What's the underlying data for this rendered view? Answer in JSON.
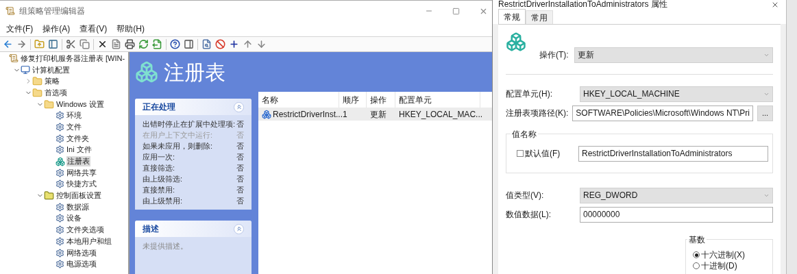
{
  "main_window": {
    "title": "组策略管理编辑器",
    "menu": [
      "文件(F)",
      "操作(A)",
      "查看(V)",
      "帮助(H)"
    ]
  },
  "tree": {
    "label": "修复打印机服务器注册表 [WIN-",
    "kind": "root",
    "selected": false,
    "children": [
      {
        "label": "计算机配置",
        "kind": "computer",
        "selected": false,
        "expanded": true,
        "children": [
          {
            "label": "策略",
            "kind": "folder",
            "selected": false,
            "expanded": false
          },
          {
            "label": "首选项",
            "kind": "folder",
            "selected": false,
            "expanded": true,
            "children": [
              {
                "label": "Windows 设置",
                "kind": "folder",
                "selected": false,
                "expanded": true,
                "children": [
                  {
                    "label": "环境",
                    "kind": "item",
                    "selected": false
                  },
                  {
                    "label": "文件",
                    "kind": "item",
                    "selected": false
                  },
                  {
                    "label": "文件夹",
                    "kind": "item",
                    "selected": false
                  },
                  {
                    "label": "Ini 文件",
                    "kind": "item",
                    "selected": false
                  },
                  {
                    "label": "注册表",
                    "kind": "registry",
                    "selected": true
                  },
                  {
                    "label": "网络共享",
                    "kind": "item",
                    "selected": false
                  },
                  {
                    "label": "快捷方式",
                    "kind": "item",
                    "selected": false
                  }
                ]
              },
              {
                "label": "控制面板设置",
                "kind": "panel",
                "selected": false,
                "expanded": true,
                "children": [
                  {
                    "label": "数据源",
                    "kind": "item",
                    "selected": false
                  },
                  {
                    "label": "设备",
                    "kind": "item",
                    "selected": false
                  },
                  {
                    "label": "文件夹选项",
                    "kind": "item",
                    "selected": false
                  },
                  {
                    "label": "本地用户和组",
                    "kind": "item",
                    "selected": false
                  },
                  {
                    "label": "网络选项",
                    "kind": "item",
                    "selected": false
                  },
                  {
                    "label": "电源选项",
                    "kind": "item",
                    "selected": false
                  }
                ]
              }
            ]
          }
        ]
      }
    ]
  },
  "header": {
    "title": "注册表"
  },
  "processing_panel": {
    "title": "正在处理",
    "expanded": true,
    "rows": [
      {
        "label": "出错时停止在扩展中处理项:",
        "value": "否",
        "disabled": false
      },
      {
        "label": "在用户上下文中运行:",
        "value": "否",
        "disabled": true
      },
      {
        "label": "如果未应用，则删除:",
        "value": "否",
        "disabled": false
      },
      {
        "label": "应用一次:",
        "value": "否",
        "disabled": false
      },
      {
        "label": "直接筛选:",
        "value": "否",
        "disabled": false
      },
      {
        "label": "由上级筛选:",
        "value": "否",
        "disabled": false
      },
      {
        "label": "直接禁用:",
        "value": "否",
        "disabled": false
      },
      {
        "label": "由上级禁用:",
        "value": "否",
        "disabled": false
      }
    ]
  },
  "description_panel": {
    "title": "描述",
    "expanded": true,
    "text": "未提供描述。"
  },
  "table": {
    "columns": [
      "名称",
      "顺序",
      "操作",
      "配置单元"
    ],
    "rows": [
      {
        "cells": [
          "RestrictDriverInst...",
          "1",
          "更新",
          "HKEY_LOCAL_MAC..."
        ],
        "selected": true
      }
    ]
  },
  "dialog": {
    "title": "RestrictDriverInstallationToAdministrators 属性",
    "tabs": [
      {
        "label": "常规",
        "selected": true
      },
      {
        "label": "常用",
        "selected": false
      }
    ],
    "action": {
      "label": "操作(T):",
      "value": "更新"
    },
    "hive": {
      "label": "配置单元(H):",
      "value": "HKEY_LOCAL_MACHINE"
    },
    "key_path": {
      "label": "注册表项路径(K):",
      "value": "SOFTWARE\\Policies\\Microsoft\\Windows NT\\Pri",
      "browse": "..."
    },
    "value_name": {
      "title": "值名称",
      "default_label": "默认值(F)",
      "default_checked": false,
      "value": "RestrictDriverInstallationToAdministrators"
    },
    "value_type": {
      "label": "值类型(V):",
      "value": "REG_DWORD"
    },
    "value_data": {
      "label": "数值数据(L):",
      "value": "00000000"
    },
    "base": {
      "title": "基数",
      "options": [
        {
          "label": "十六进制(X)",
          "selected": true
        },
        {
          "label": "十进制(D)",
          "selected": false
        }
      ]
    }
  }
}
